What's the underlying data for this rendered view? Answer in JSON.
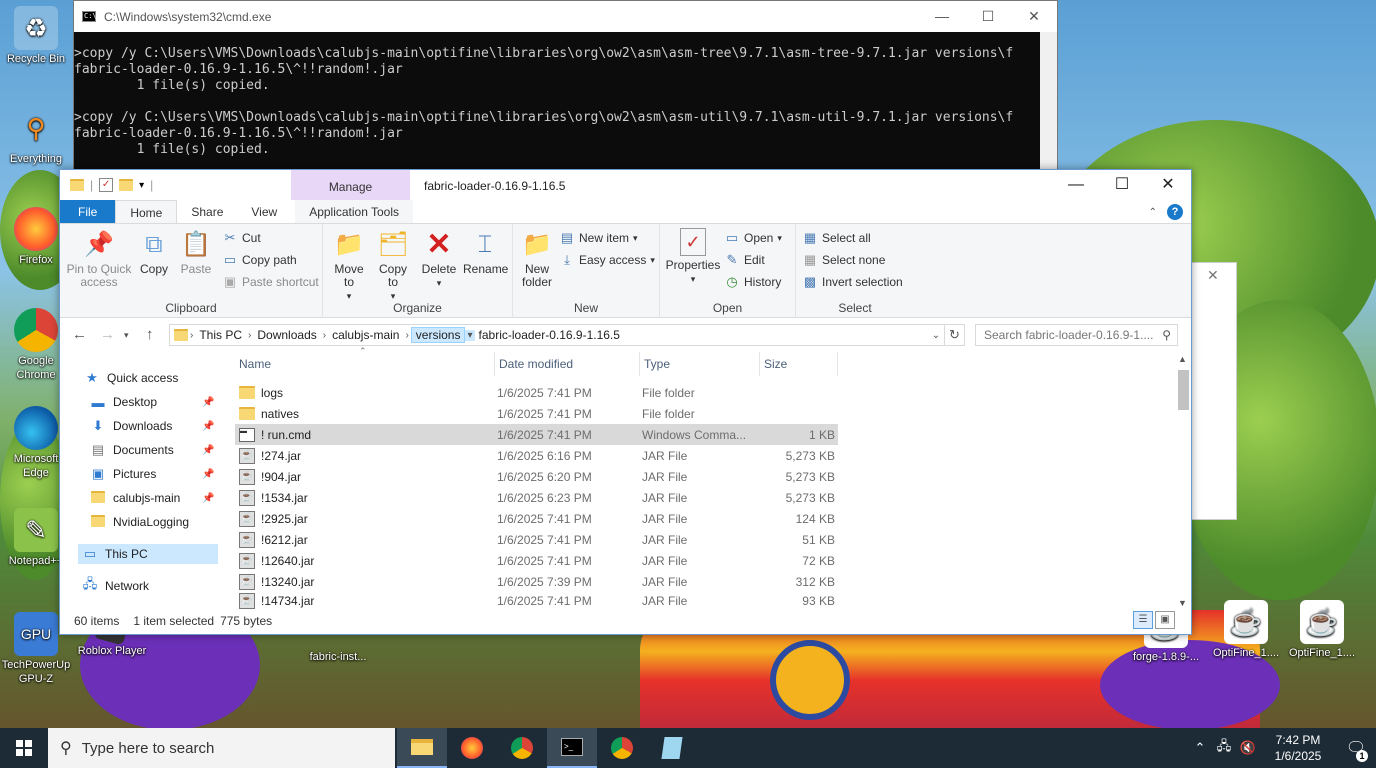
{
  "desktop": {
    "icons_left": [
      {
        "label": "Recycle Bin",
        "icon": "recycle-bin-icon"
      },
      {
        "label": "Everything",
        "icon": "everything-icon"
      },
      {
        "label": "Firefox",
        "icon": "firefox-icon"
      },
      {
        "label": "Google Chrome",
        "icon": "chrome-icon"
      },
      {
        "label": "Microsoft Edge",
        "icon": "edge-icon"
      },
      {
        "label": "Notepad++",
        "icon": "notepadpp-icon"
      }
    ],
    "icons_bottom": [
      {
        "label": "TechPowerUp GPU-Z",
        "icon": "gpuz-icon"
      },
      {
        "label": "Roblox Player",
        "icon": "roblox-icon"
      },
      {
        "label": "fabric-inst...",
        "icon": "java-icon"
      },
      {
        "label": "forge-1.8.9-...",
        "icon": "java-icon"
      },
      {
        "label": "OptiFine_1....",
        "icon": "java-icon"
      },
      {
        "label": "OptiFine_1....",
        "icon": "java-icon"
      }
    ]
  },
  "cmd": {
    "title": "C:\\Windows\\system32\\cmd.exe",
    "lines": [
      ">copy /y C:\\Users\\VMS\\Downloads\\calubjs-main\\optifine\\libraries\\org\\ow2\\asm\\asm-tree\\9.7.1\\asm-tree-9.7.1.jar versions\\f",
      "fabric-loader-0.16.9-1.16.5\\^!!random!.jar",
      "        1 file(s) copied.",
      "",
      ">copy /y C:\\Users\\VMS\\Downloads\\calubjs-main\\optifine\\libraries\\org\\ow2\\asm\\asm-util\\9.7.1\\asm-util-9.7.1.jar versions\\f",
      "fabric-loader-0.16.9-1.16.5\\^!!random!.jar",
      "        1 file(s) copied."
    ]
  },
  "explorer": {
    "title": "fabric-loader-0.16.9-1.16.5",
    "contextual_tab": "Manage",
    "tabs": [
      "File",
      "Home",
      "Share",
      "View",
      "Application Tools"
    ],
    "ribbon": {
      "clipboard": {
        "label": "Clipboard",
        "pin": "Pin to Quick access",
        "copy": "Copy",
        "paste": "Paste",
        "cut": "Cut",
        "copy_path": "Copy path",
        "paste_shortcut": "Paste shortcut"
      },
      "organize": {
        "label": "Organize",
        "move_to": "Move to",
        "copy_to": "Copy to",
        "delete": "Delete",
        "rename": "Rename"
      },
      "new": {
        "label": "New",
        "new_folder": "New folder",
        "new_item": "New item",
        "easy_access": "Easy access"
      },
      "open": {
        "label": "Open",
        "properties": "Properties",
        "open": "Open",
        "edit": "Edit",
        "history": "History"
      },
      "select": {
        "label": "Select",
        "select_all": "Select all",
        "select_none": "Select none",
        "invert": "Invert selection"
      }
    },
    "breadcrumb": [
      "This PC",
      "Downloads",
      "calubjs-main",
      "versions",
      "fabric-loader-0.16.9-1.16.5"
    ],
    "search_placeholder": "Search fabric-loader-0.16.9-1....",
    "nav": [
      {
        "label": "Quick access",
        "icon": "star-icon",
        "pinned": false
      },
      {
        "label": "Desktop",
        "icon": "desktop-icon",
        "pinned": true
      },
      {
        "label": "Downloads",
        "icon": "download-icon",
        "pinned": true
      },
      {
        "label": "Documents",
        "icon": "documents-icon",
        "pinned": true
      },
      {
        "label": "Pictures",
        "icon": "pictures-icon",
        "pinned": true
      },
      {
        "label": "calubjs-main",
        "icon": "folder-icon",
        "pinned": true
      },
      {
        "label": "NvidiaLogging",
        "icon": "folder-icon",
        "pinned": false
      },
      {
        "label": "This PC",
        "icon": "computer-icon",
        "pinned": false
      },
      {
        "label": "Network",
        "icon": "network-icon",
        "pinned": false
      }
    ],
    "columns": [
      "Name",
      "Date modified",
      "Type",
      "Size"
    ],
    "files": [
      {
        "name": "logs",
        "date": "1/6/2025 7:41 PM",
        "type": "File folder",
        "size": "",
        "kind": "folder"
      },
      {
        "name": "natives",
        "date": "1/6/2025 7:41 PM",
        "type": "File folder",
        "size": "",
        "kind": "folder"
      },
      {
        "name": "! run.cmd",
        "date": "1/6/2025 7:41 PM",
        "type": "Windows Comma...",
        "size": "1 KB",
        "kind": "cmd"
      },
      {
        "name": "!274.jar",
        "date": "1/6/2025 6:16 PM",
        "type": "JAR File",
        "size": "5,273 KB",
        "kind": "jar"
      },
      {
        "name": "!904.jar",
        "date": "1/6/2025 6:20 PM",
        "type": "JAR File",
        "size": "5,273 KB",
        "kind": "jar"
      },
      {
        "name": "!1534.jar",
        "date": "1/6/2025 6:23 PM",
        "type": "JAR File",
        "size": "5,273 KB",
        "kind": "jar"
      },
      {
        "name": "!2925.jar",
        "date": "1/6/2025 7:41 PM",
        "type": "JAR File",
        "size": "124 KB",
        "kind": "jar"
      },
      {
        "name": "!6212.jar",
        "date": "1/6/2025 7:41 PM",
        "type": "JAR File",
        "size": "51 KB",
        "kind": "jar"
      },
      {
        "name": "!12640.jar",
        "date": "1/6/2025 7:41 PM",
        "type": "JAR File",
        "size": "72 KB",
        "kind": "jar"
      },
      {
        "name": "!13240.jar",
        "date": "1/6/2025 7:39 PM",
        "type": "JAR File",
        "size": "312 KB",
        "kind": "jar"
      },
      {
        "name": "!14734.jar",
        "date": "1/6/2025 7:41 PM",
        "type": "JAR File",
        "size": "93 KB",
        "kind": "jar"
      }
    ],
    "status": {
      "items": "60 items",
      "selected": "1 item selected",
      "size": "775 bytes"
    }
  },
  "taskbar": {
    "search_placeholder": "Type here to search",
    "apps": [
      "file-explorer-icon",
      "firefox-icon",
      "chrome-icon",
      "cmd-icon",
      "chrome-alt-icon",
      "notepad-icon"
    ],
    "time": "7:42 PM",
    "date": "1/6/2025",
    "notifications": "1"
  }
}
